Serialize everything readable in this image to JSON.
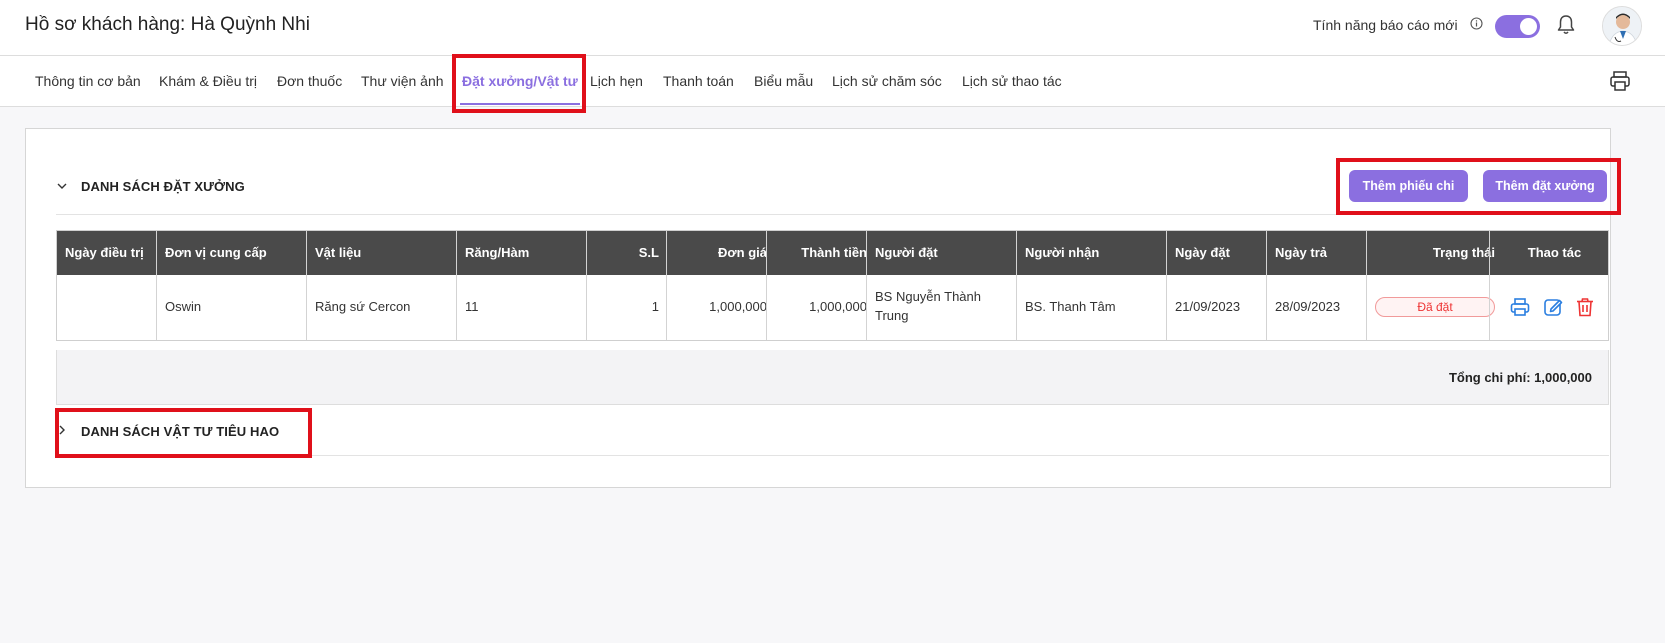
{
  "header": {
    "title": "Hồ sơ khách hàng: Hà Quỳnh Nhi",
    "new_report_label": "Tính năng báo cáo mới",
    "toggle_on": true,
    "accent": "#8b6fe0"
  },
  "tabs": [
    {
      "label": "Thông tin cơ bản"
    },
    {
      "label": "Khám & Điều trị"
    },
    {
      "label": "Đơn thuốc"
    },
    {
      "label": "Thư viện ảnh"
    },
    {
      "label": "Đặt xưởng/Vật tư",
      "active": true
    },
    {
      "label": "Lịch hẹn"
    },
    {
      "label": "Thanh toán"
    },
    {
      "label": "Biểu mẫu"
    },
    {
      "label": "Lịch sử chăm sóc"
    },
    {
      "label": "Lịch sử thao tác"
    }
  ],
  "section_lab": {
    "title": "DANH SÁCH ĐẶT XƯỞNG",
    "buttons": {
      "add_expense": "Thêm phiếu chi",
      "add_lab_order": "Thêm đặt xưởng"
    },
    "columns": [
      "Ngày điều trị",
      "Đơn vị cung cấp",
      "Vật liệu",
      "Răng/Hàm",
      "S.L",
      "Đơn giá",
      "Thành tiền",
      "Người đặt",
      "Người nhận",
      "Ngày đặt",
      "Ngày trả",
      "Trạng thái",
      "Thao tác"
    ],
    "rows": [
      {
        "treatment_date": "",
        "supplier": "Oswin",
        "material": "Răng sứ Cercon",
        "tooth": "11",
        "qty": "1",
        "unit_price": "1,000,000",
        "amount": "1,000,000",
        "ordered_by_line1": "BS Nguyễn Thành",
        "ordered_by_line2": "Trung",
        "receiver": "BS. Thanh Tâm",
        "order_date": "21/09/2023",
        "return_date": "28/09/2023",
        "status": "Đã đặt"
      }
    ],
    "total": "Tổng chi phí: 1,000,000"
  },
  "section_consumables": {
    "title": "DANH SÁCH VẬT TƯ TIÊU HAO"
  },
  "colors": {
    "accent": "#8b6fe0",
    "table_header": "#4a4a4a",
    "highlight": "#e0101a",
    "status_red": "#e33333",
    "action_blue": "#2b7fe0"
  }
}
